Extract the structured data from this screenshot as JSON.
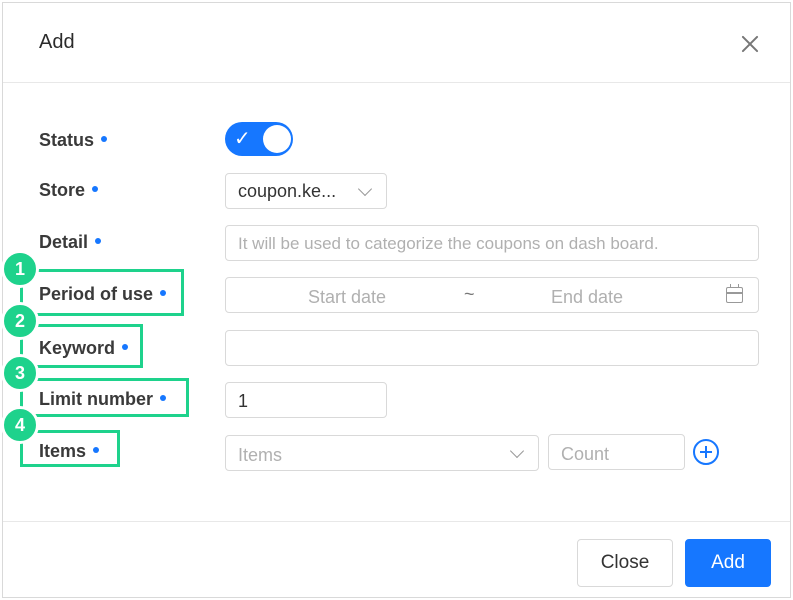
{
  "dialog": {
    "title": "Add"
  },
  "form": {
    "status_label": "Status",
    "store_label": "Store",
    "store_value": "coupon.ke...",
    "detail_label": "Detail",
    "detail_placeholder": "It will be used to categorize the coupons on dash board.",
    "period_label": "Period of use",
    "period_start_placeholder": "Start date",
    "period_separator": "~",
    "period_end_placeholder": "End date",
    "keyword_label": "Keyword",
    "keyword_value": "",
    "limit_label": "Limit number",
    "limit_value": "1",
    "items_label": "Items",
    "items_placeholder": "Items",
    "count_placeholder": "Count",
    "status_on": true
  },
  "footer": {
    "close_label": "Close",
    "add_label": "Add"
  },
  "annotations": {
    "badges": [
      "1",
      "2",
      "3",
      "4"
    ]
  },
  "colors": {
    "accent": "#1677ff",
    "highlight": "#1ed28c"
  },
  "icons": {
    "close": "close-icon",
    "check": "check-icon",
    "chevron": "chevron-down-icon",
    "calendar": "calendar-icon",
    "add_item": "plus-circle-icon"
  }
}
